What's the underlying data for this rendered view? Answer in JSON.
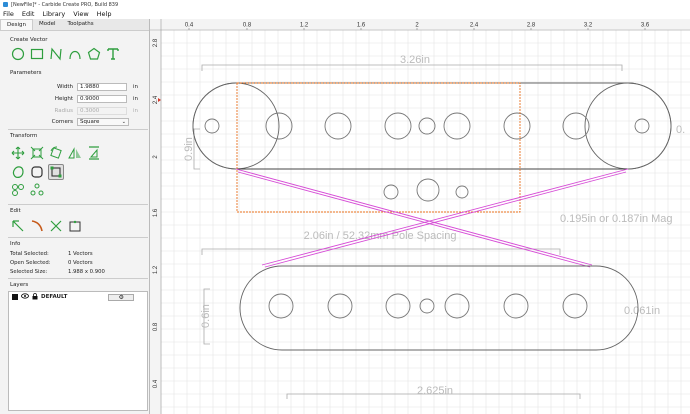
{
  "window": {
    "title": "[NewFile]* - Carbide Create PRO, Build 839"
  },
  "menu": [
    "File",
    "Edit",
    "Library",
    "View",
    "Help"
  ],
  "tabs": [
    "Design",
    "Model",
    "Toolpaths"
  ],
  "create_vector": {
    "title": "Create Vector",
    "icons": [
      "circle-icon",
      "rectangle-icon",
      "polyline-icon",
      "curve-icon",
      "polygon-icon",
      "text-icon"
    ]
  },
  "parameters": {
    "title": "Parameters",
    "width": {
      "label": "Width",
      "value": "1.9880",
      "unit": "in"
    },
    "height": {
      "label": "Height",
      "value": "0.9000",
      "unit": "in"
    },
    "radius": {
      "label": "Radius",
      "value": "0.3000",
      "unit": "in"
    },
    "corners": {
      "label": "Corners",
      "value": "Square"
    }
  },
  "transform": {
    "title": "Transform"
  },
  "edit": {
    "title": "Edit"
  },
  "info": {
    "title": "Info",
    "total_selected": {
      "label": "Total Selected:",
      "value": "1 Vectors"
    },
    "open_selected": {
      "label": "Open Selected:",
      "value": "0 Vectors"
    },
    "selected_size": {
      "label": "Selected Size:",
      "value": "1.988 x 0.900"
    }
  },
  "layers": {
    "title": "Layers",
    "items": [
      {
        "name": "DEFAULT",
        "color": "#111111"
      }
    ]
  },
  "ruler": {
    "top_ticks": [
      "0.4",
      "0.8",
      "1.2",
      "1.6",
      "2",
      "2.4",
      "2.8",
      "3.2",
      "3.6"
    ],
    "left_ticks": [
      "2.8",
      "2.4",
      "2",
      "1.6",
      "1.2",
      "0.8",
      "0.4"
    ]
  },
  "annotations": {
    "top_width": "3.26in",
    "right_partial": "0.",
    "left_partial": "0.9in",
    "pole_spacing": "2.06in / 52.32mm Pole Spacing",
    "mag": "0.195in or 0.187in Mag",
    "bottom_height": "0.6in",
    "bottom_right": "0.061in",
    "bottom_width": "2.625in"
  },
  "colors": {
    "selection": "#e8701e",
    "magenta": "#d64bd6",
    "vector": "#555555",
    "grid": "#e2e2e2",
    "accent_green": "#2e9e3e"
  }
}
